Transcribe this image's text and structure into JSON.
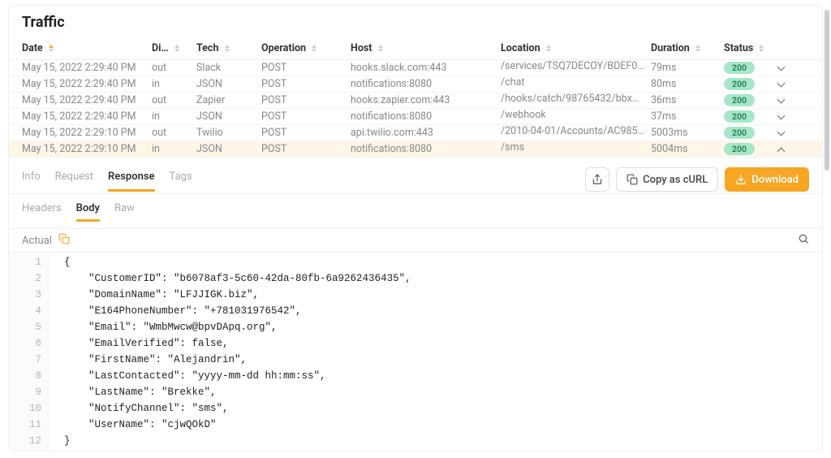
{
  "panel_title": "Traffic",
  "columns": {
    "date": "Date",
    "direction": "Di…",
    "tech": "Tech",
    "operation": "Operation",
    "host": "Host",
    "location": "Location",
    "duration": "Duration",
    "status": "Status"
  },
  "rows": [
    {
      "date": "May 15, 2022 2:29:40 PM",
      "dir": "out",
      "tech": "Slack",
      "op": "POST",
      "host": "hooks.slack.com:443",
      "loc": "/services/TSQ7DECOY/BDEF0…",
      "dur": "79ms",
      "status": "200",
      "expanded": false
    },
    {
      "date": "May 15, 2022 2:29:40 PM",
      "dir": "in",
      "tech": "JSON",
      "op": "POST",
      "host": "notifications:8080",
      "loc": "/chat",
      "dur": "80ms",
      "status": "200",
      "expanded": false
    },
    {
      "date": "May 15, 2022 2:29:40 PM",
      "dir": "out",
      "tech": "Zapier",
      "op": "POST",
      "host": "hooks.zapier.com:443",
      "loc": "/hooks/catch/98765432/bbx…",
      "dur": "36ms",
      "status": "200",
      "expanded": false
    },
    {
      "date": "May 15, 2022 2:29:40 PM",
      "dir": "in",
      "tech": "JSON",
      "op": "POST",
      "host": "notifications:8080",
      "loc": "/webhook",
      "dur": "37ms",
      "status": "200",
      "expanded": false
    },
    {
      "date": "May 15, 2022 2:29:10 PM",
      "dir": "out",
      "tech": "Twilio",
      "op": "POST",
      "host": "api.twilio.com:443",
      "loc": "/2010-04-01/Accounts/AC985…",
      "dur": "5003ms",
      "status": "200",
      "expanded": false
    },
    {
      "date": "May 15, 2022 2:29:10 PM",
      "dir": "in",
      "tech": "JSON",
      "op": "POST",
      "host": "notifications:8080",
      "loc": "/sms",
      "dur": "5004ms",
      "status": "200",
      "expanded": true
    }
  ],
  "detail_tabs": {
    "info": "Info",
    "request": "Request",
    "response": "Response",
    "tags": "Tags"
  },
  "detail_active_tab": "response",
  "copy_as_curl": "Copy as cURL",
  "download": "Download",
  "subtabs": {
    "headers": "Headers",
    "body": "Body",
    "raw": "Raw"
  },
  "subtab_active": "body",
  "actual_label": "Actual",
  "code_lines": [
    "{",
    "    \"CustomerID\": \"b6078af3-5c60-42da-80fb-6a9262436435\",",
    "    \"DomainName\": \"LFJJIGK.biz\",",
    "    \"E164PhoneNumber\": \"+781031976542\",",
    "    \"Email\": \"WmbMwcw@bpvDApq.org\",",
    "    \"EmailVerified\": false,",
    "    \"FirstName\": \"Alejandrin\",",
    "    \"LastContacted\": \"yyyy-mm-dd hh:mm:ss\",",
    "    \"LastName\": \"Brekke\",",
    "    \"NotifyChannel\": \"sms\",",
    "    \"UserName\": \"cjwQOkD\"",
    "}"
  ],
  "colors": {
    "accent": "#f6a623",
    "status_green": "#a7e6c6"
  }
}
